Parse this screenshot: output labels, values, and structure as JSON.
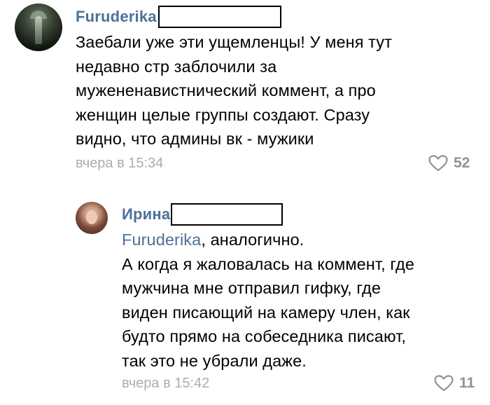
{
  "comments": [
    {
      "author": "Furuderika",
      "lines": [
        "Заебали уже эти ущемленцы! У меня тут",
        "недавно стр заблочили за",
        "мужененавистнический коммент, а про",
        "женщин целые группы создают. Сразу",
        "видно, что админы вк - мужики"
      ],
      "time": "вчера в 15:34",
      "likes": "52"
    },
    {
      "author": "Ирина",
      "mention": "Furuderika",
      "first_line_rest": ", аналогично.",
      "lines": [
        "А когда я жаловалась на коммент, где",
        "мужчина мне отправил гифку, где",
        "виден писающий на камеру член, как",
        "будто прямо на собеседника писают,",
        "так это не убрали даже."
      ],
      "time": "вчера в 15:42",
      "likes": "11"
    }
  ],
  "icons": {
    "like": "heart-outline-icon"
  },
  "colors": {
    "author": "#4d7198",
    "meta": "#a9adb3",
    "likes": "#8e9399"
  }
}
